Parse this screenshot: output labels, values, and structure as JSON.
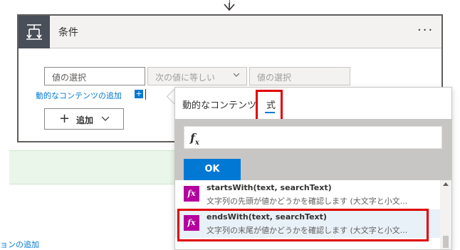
{
  "card": {
    "title": "条件",
    "more": "···",
    "left_field_placeholder": "値の選択",
    "operator": "次の値に等しい",
    "right_field_placeholder": "値の選択",
    "dynamic_content_link": "動的なコンテンツの追加",
    "add_button": "追加"
  },
  "panel": {
    "tabs": [
      {
        "label": "動的なコンテンツ"
      },
      {
        "label": "式"
      }
    ],
    "active_tab": "式",
    "expression_placeholder": "",
    "ok_button": "OK",
    "functions": [
      {
        "name": "startsWith(text, searchText)",
        "description": "文字列の先頭が値かどうかを確認します (大文字と小文..."
      },
      {
        "name": "endsWith(text, searchText)",
        "description": "文字列の末尾が値かどうかを確認します (大文字と小文..."
      }
    ]
  },
  "bottom": {
    "partial_link": "ョンの追加"
  },
  "colors": {
    "accent": "#0078d4",
    "function_icon": "#b4009e",
    "highlight": "#e00000",
    "header_icon_bg": "#484f58"
  }
}
